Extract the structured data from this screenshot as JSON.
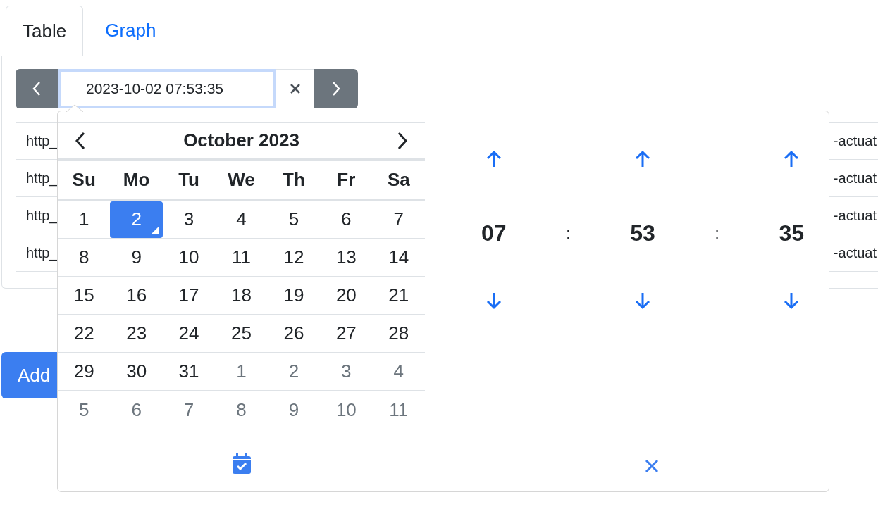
{
  "tabs": [
    {
      "label": "Table",
      "selected": true
    },
    {
      "label": "Graph",
      "selected": false
    }
  ],
  "date_bar": {
    "value": "2023-10-02 07:53:35"
  },
  "table": {
    "rows": [
      {
        "column_1": "http_",
        "column_2": "-actuat"
      },
      {
        "column_1": "http_",
        "column_2": "-actuat"
      },
      {
        "column_1": "http_",
        "column_2": "-actuat"
      },
      {
        "column_1": "http_",
        "column_2": "-actuat"
      }
    ]
  },
  "add_button": "Add",
  "picker": {
    "title": "October 2023",
    "weekdays": [
      "Su",
      "Mo",
      "Tu",
      "We",
      "Th",
      "Fr",
      "Sa"
    ],
    "weeks": [
      [
        {
          "day": "1",
          "selected": false,
          "today": false,
          "muted": false
        },
        {
          "day": "2",
          "selected": true,
          "today": true,
          "muted": false
        },
        {
          "day": "3",
          "selected": false,
          "today": false,
          "muted": false
        },
        {
          "day": "4",
          "selected": false,
          "today": false,
          "muted": false
        },
        {
          "day": "5",
          "selected": false,
          "today": false,
          "muted": false
        },
        {
          "day": "6",
          "selected": false,
          "today": false,
          "muted": false
        },
        {
          "day": "7",
          "selected": false,
          "today": false,
          "muted": false
        }
      ],
      [
        {
          "day": "8",
          "selected": false,
          "today": false,
          "muted": false
        },
        {
          "day": "9",
          "selected": false,
          "today": false,
          "muted": false
        },
        {
          "day": "10",
          "selected": false,
          "today": false,
          "muted": false
        },
        {
          "day": "11",
          "selected": false,
          "today": false,
          "muted": false
        },
        {
          "day": "12",
          "selected": false,
          "today": false,
          "muted": false
        },
        {
          "day": "13",
          "selected": false,
          "today": false,
          "muted": false
        },
        {
          "day": "14",
          "selected": false,
          "today": false,
          "muted": false
        }
      ],
      [
        {
          "day": "15",
          "selected": false,
          "today": false,
          "muted": false
        },
        {
          "day": "16",
          "selected": false,
          "today": false,
          "muted": false
        },
        {
          "day": "17",
          "selected": false,
          "today": false,
          "muted": false
        },
        {
          "day": "18",
          "selected": false,
          "today": false,
          "muted": false
        },
        {
          "day": "19",
          "selected": false,
          "today": false,
          "muted": false
        },
        {
          "day": "20",
          "selected": false,
          "today": false,
          "muted": false
        },
        {
          "day": "21",
          "selected": false,
          "today": false,
          "muted": false
        }
      ],
      [
        {
          "day": "22",
          "selected": false,
          "today": false,
          "muted": false
        },
        {
          "day": "23",
          "selected": false,
          "today": false,
          "muted": false
        },
        {
          "day": "24",
          "selected": false,
          "today": false,
          "muted": false
        },
        {
          "day": "25",
          "selected": false,
          "today": false,
          "muted": false
        },
        {
          "day": "26",
          "selected": false,
          "today": false,
          "muted": false
        },
        {
          "day": "27",
          "selected": false,
          "today": false,
          "muted": false
        },
        {
          "day": "28",
          "selected": false,
          "today": false,
          "muted": false
        }
      ],
      [
        {
          "day": "29",
          "selected": false,
          "today": false,
          "muted": false
        },
        {
          "day": "30",
          "selected": false,
          "today": false,
          "muted": false
        },
        {
          "day": "31",
          "selected": false,
          "today": false,
          "muted": false
        },
        {
          "day": "1",
          "selected": false,
          "today": false,
          "muted": true
        },
        {
          "day": "2",
          "selected": false,
          "today": false,
          "muted": true
        },
        {
          "day": "3",
          "selected": false,
          "today": false,
          "muted": true
        },
        {
          "day": "4",
          "selected": false,
          "today": false,
          "muted": true
        }
      ],
      [
        {
          "day": "5",
          "selected": false,
          "today": false,
          "muted": true
        },
        {
          "day": "6",
          "selected": false,
          "today": false,
          "muted": true
        },
        {
          "day": "7",
          "selected": false,
          "today": false,
          "muted": true
        },
        {
          "day": "8",
          "selected": false,
          "today": false,
          "muted": true
        },
        {
          "day": "9",
          "selected": false,
          "today": false,
          "muted": true
        },
        {
          "day": "10",
          "selected": false,
          "today": false,
          "muted": true
        },
        {
          "day": "11",
          "selected": false,
          "today": false,
          "muted": true
        }
      ]
    ],
    "time": {
      "hours": "07",
      "minutes": "53",
      "seconds": "35",
      "separators": [
        ":",
        ":"
      ]
    }
  }
}
